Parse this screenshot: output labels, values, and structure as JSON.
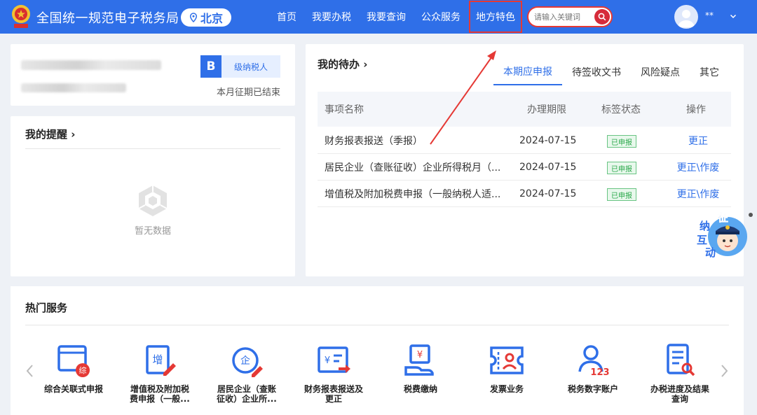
{
  "header": {
    "site_title": "全国统一规范电子税务局",
    "region": "北京",
    "nav": [
      "首页",
      "我要办税",
      "我要查询",
      "公众服务",
      "地方特色"
    ],
    "search_placeholder": "请输入关键词",
    "username": "**",
    "brand_color": "#2f6fe8",
    "highlight_color": "#e53935"
  },
  "taxpayer": {
    "grade_letter": "B",
    "grade_label": "级纳税人",
    "period_status": "本月征期已结束"
  },
  "reminders": {
    "title": "我的提醒",
    "empty_text": "暂无数据"
  },
  "todo": {
    "title": "我的待办",
    "tabs": [
      "本期应申报",
      "待签收文书",
      "风险疑点",
      "其它"
    ],
    "active_tab": 0,
    "columns": [
      "事项名称",
      "办理期限",
      "标签状态",
      "操作"
    ],
    "rows": [
      {
        "name": "财务报表报送（季报）",
        "deadline": "2024-07-15",
        "status": "已申报",
        "action": "更正"
      },
      {
        "name": "居民企业（查账征收）企业所得税月（...",
        "deadline": "2024-07-15",
        "status": "已申报",
        "action": "更正\\作废"
      },
      {
        "name": "增值税及附加税费申报（一般纳税人适...",
        "deadline": "2024-07-15",
        "status": "已申报",
        "action": "更正\\作废"
      }
    ]
  },
  "mascot": {
    "text": [
      "征",
      "纳",
      "互",
      "动"
    ]
  },
  "hot_services": {
    "title": "热门服务",
    "items": [
      {
        "line1": "综合关联式申报",
        "line2": "",
        "icon": "composite-report-icon"
      },
      {
        "line1": "增值税及附加税",
        "line2": "费申报（一般...",
        "icon": "vat-report-icon"
      },
      {
        "line1": "居民企业（查账",
        "line2": "征收）企业所...",
        "icon": "enterprise-tax-icon"
      },
      {
        "line1": "财务报表报送及",
        "line2": "更正",
        "icon": "financial-statement-icon"
      },
      {
        "line1": "税费缴纳",
        "line2": "",
        "icon": "tax-payment-icon"
      },
      {
        "line1": "发票业务",
        "line2": "",
        "icon": "invoice-icon"
      },
      {
        "line1": "税务数字账户",
        "line2": "",
        "icon": "digital-account-icon"
      },
      {
        "line1": "办税进度及结果",
        "line2": "查询",
        "icon": "progress-query-icon"
      }
    ]
  }
}
